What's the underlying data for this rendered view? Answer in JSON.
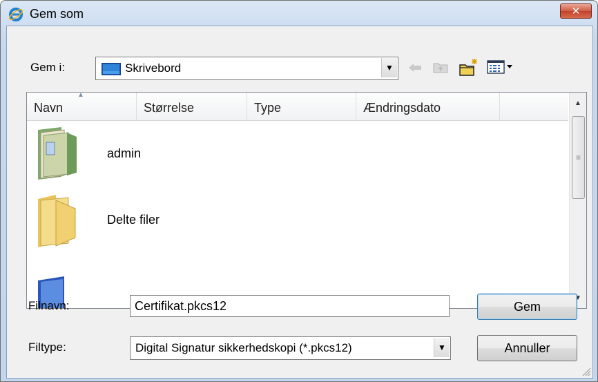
{
  "window": {
    "title": "Gem som",
    "close_icon": "close-icon"
  },
  "toolbar": {
    "location_label": "Gem i:",
    "location_value": "Skrivebord",
    "icons": [
      "back-arrow-icon",
      "up-folder-icon",
      "new-folder-icon",
      "view-menu-icon"
    ]
  },
  "list": {
    "columns": [
      "Navn",
      "Størrelse",
      "Type",
      "Ændringsdato"
    ],
    "items": [
      {
        "name": "admin",
        "icon": "user-folder-icon"
      },
      {
        "name": "Delte filer",
        "icon": "folder-icon"
      },
      {
        "name": "",
        "icon": "computer-icon"
      }
    ]
  },
  "filename": {
    "label": "Filnavn:",
    "value": "Certifikat.pkcs12"
  },
  "filetype": {
    "label": "Filtype:",
    "value": "Digital Signatur sikkerhedskopi (*.pkcs12)"
  },
  "buttons": {
    "save": "Gem",
    "cancel": "Annuller"
  },
  "colors": {
    "title_gradient_top": "#dbe7f5",
    "client_bg": "#f0f0f0",
    "close_red": "#c2412a",
    "default_button_border": "#3c7fb1"
  }
}
